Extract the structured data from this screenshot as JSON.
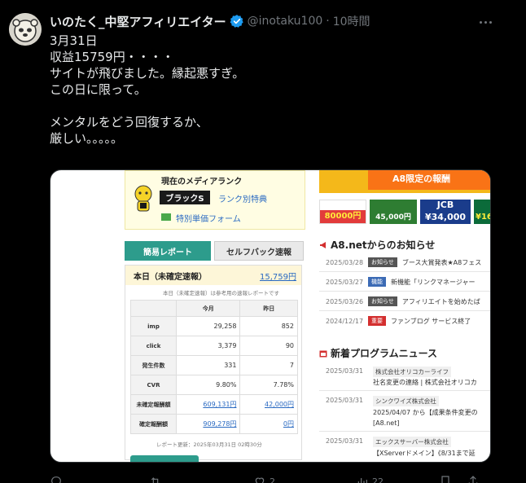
{
  "post": {
    "display_name": "いのたく_中堅アフィリエイター",
    "handle": "@inotaku100",
    "separator": "·",
    "time": "10時間",
    "text_lines": [
      "3月31日",
      "収益15759円・・・・",
      "サイトが飛びました。縁起悪すぎ。",
      "この日に限って。",
      "",
      "メンタルをどう回復するか、",
      "厳しい。。。。。"
    ],
    "actions": {
      "reply_count": "",
      "repost_count": "",
      "like_count": "2",
      "views_count": "22"
    }
  },
  "screenshot": {
    "rank": {
      "title": "現在のメディアランク",
      "badge": "ブラックS",
      "link": "ランク別特典",
      "form_link": "特別単価フォーム"
    },
    "tabs": [
      "簡易レポート",
      "セルフバック速報"
    ],
    "today": {
      "label": "本日（未確定速報）",
      "value": "15,759円",
      "note": "本日（未確定速報）は参考用の速報レポートです"
    },
    "table": {
      "headers": [
        "",
        "今月",
        "昨日"
      ],
      "rows": [
        {
          "label": "imp",
          "month": "29,258",
          "yesterday": "852"
        },
        {
          "label": "click",
          "month": "3,379",
          "yesterday": "90"
        },
        {
          "label": "発生件数",
          "month": "331",
          "yesterday": "7"
        },
        {
          "label": "CVR",
          "month": "9.80%",
          "yesterday": "7.78%"
        },
        {
          "label": "未確定報酬額",
          "month": "609,131円",
          "yesterday": "42,000円"
        },
        {
          "label": "確定報酬額",
          "month": "909,278円",
          "yesterday": "0円"
        }
      ]
    },
    "update_note": "レポート更新：2025年03月31日 02時30分",
    "banners": {
      "top": "A8限定の報酬",
      "b1_value": "80000円",
      "b2_value": "45,000円",
      "b3_top": "JCB",
      "b3_value": "¥34,000",
      "b4_value": "¥16"
    },
    "news_title": "A8.netからのお知らせ",
    "news": [
      {
        "date": "2025/03/28",
        "tag": "お知らせ",
        "tag_type": "info",
        "text": "ブース大賞発表★A8フェス"
      },
      {
        "date": "2025/03/27",
        "tag": "機能",
        "tag_type": "feat",
        "text": "新機能「リンクマネージャー"
      },
      {
        "date": "2025/03/26",
        "tag": "お知らせ",
        "tag_type": "info",
        "text": "アフィリエイトを始めたば"
      },
      {
        "date": "2024/12/17",
        "tag": "重要",
        "tag_type": "imp",
        "text": "ファンブログ サービス終了"
      }
    ],
    "programs_title": "新着プログラムニュース",
    "programs": [
      {
        "date": "2025/03/31",
        "company": "株式会社オリコカーライフ",
        "desc": "社名変更の連絡 | 株式会社オリコカ"
      },
      {
        "date": "2025/03/31",
        "company": "シンクワイズ株式会社",
        "desc": "2025/04/07 から【成果条件変更の",
        "desc2": "[A8.net]"
      },
      {
        "date": "2025/03/31",
        "company": "エックスサーバー株式会社",
        "desc": "【XServerドメイン】《8/31まで延"
      }
    ]
  },
  "colors": {
    "accent": "#1d9bf0",
    "teal": "#2d9c8c",
    "link": "#2a6ac2"
  }
}
